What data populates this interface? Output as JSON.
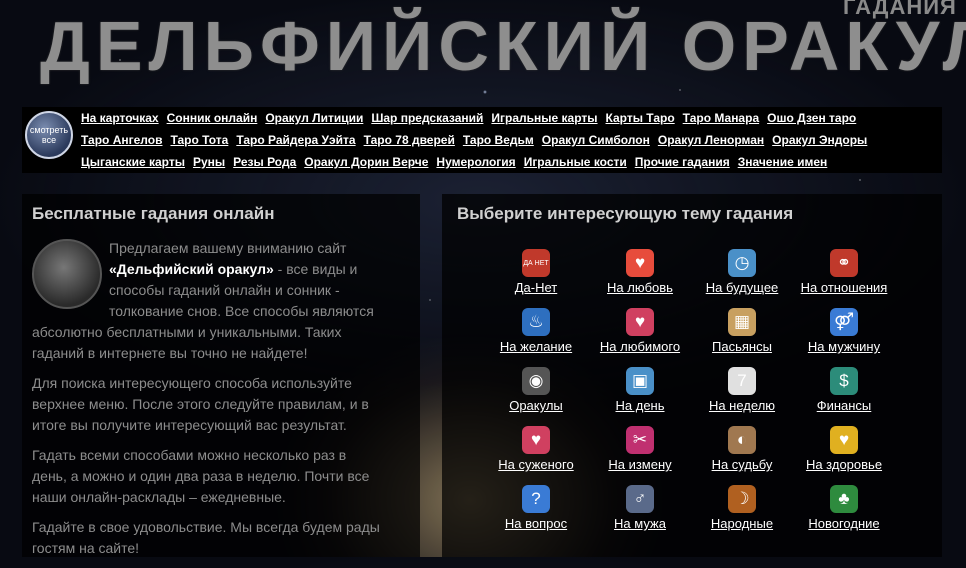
{
  "header": {
    "title": "ДЕЛЬФИЙСКИЙ ОРАКУЛ",
    "subtitle": "ГАДАНИЯ"
  },
  "menu": {
    "show_all": "смотреть все",
    "rows": [
      [
        "На карточках",
        "Сонник онлайн",
        "Оракул Литиции",
        "Шар предсказаний",
        "Игральные карты",
        "Карты Таро",
        "Таро Манара",
        "Ошо Дзен таро"
      ],
      [
        "Таро Ангелов",
        "Таро Тота",
        "Таро Райдера Уэйта",
        "Таро 78 дверей",
        "Таро Ведьм",
        "Оракул Симболон",
        "Оракул Ленорман",
        "Оракул Эндоры"
      ],
      [
        "Цыганские карты",
        "Руны",
        "Резы Рода",
        "Оракул Дорин Верче",
        "Нумерология",
        "Игральные кости",
        "Прочие гадания",
        "Значение имен"
      ]
    ]
  },
  "left_panel": {
    "title": "Бесплатные гадания онлайн",
    "p1_before": "Предлагаем вашему вниманию сайт ",
    "p1_bold": "«Дельфийский оракул»",
    "p1_after": " - все виды и способы гаданий онлайн и сонник - толкование снов. Все способы являются абсолютно бесплатными и уникальными. Таких гаданий в интернете вы точно не найдете!",
    "p2": "Для поиска интересующего способа используйте верхнее меню. После этого следуйте правилам, и в итоге вы получите интересующий вас результат.",
    "p3": "Гадать всеми способами можно несколько раз в день, а можно и один два раза в неделю. Почти все наши онлайн-расклады – ежедневные.",
    "p4": "Гадайте в свое удовольствие. Мы всегда будем рады гостям на сайте!"
  },
  "right_panel": {
    "title": "Выберите интересующую тему гадания",
    "items": [
      {
        "label": "Да-Нет",
        "icon": "yes-no-icon",
        "glyph": "ДА НЕТ",
        "color": "#c0392b"
      },
      {
        "label": "На любовь",
        "icon": "hearts-icon",
        "glyph": "♥",
        "color": "#e74c3c"
      },
      {
        "label": "На будущее",
        "icon": "clock-icon",
        "glyph": "◷",
        "color": "#4a90c8"
      },
      {
        "label": "На отношения",
        "icon": "couple-icon",
        "glyph": "⚭",
        "color": "#c0392b"
      },
      {
        "label": "На желание",
        "icon": "genie-lamp-icon",
        "glyph": "♨",
        "color": "#2e6fbf"
      },
      {
        "label": "На любимого",
        "icon": "heart-icon",
        "glyph": "♥",
        "color": "#d04060"
      },
      {
        "label": "Пасьянсы",
        "icon": "cards-icon",
        "glyph": "▦",
        "color": "#c8a060"
      },
      {
        "label": "На мужчину",
        "icon": "people-icon",
        "glyph": "⚤",
        "color": "#3a7bd5"
      },
      {
        "label": "Оракулы",
        "icon": "oracle-icon",
        "glyph": "◉",
        "color": "#555555"
      },
      {
        "label": "На день",
        "icon": "calendar-day-icon",
        "glyph": "▣",
        "color": "#4a90c8"
      },
      {
        "label": "На неделю",
        "icon": "calendar-week-icon",
        "glyph": "7",
        "color": "#e0e0e0"
      },
      {
        "label": "Финансы",
        "icon": "money-icon",
        "glyph": "$",
        "color": "#2c8c7a"
      },
      {
        "label": "На суженого",
        "icon": "hand-heart-icon",
        "glyph": "♥",
        "color": "#d04060"
      },
      {
        "label": "На измену",
        "icon": "betrayal-icon",
        "glyph": "✂",
        "color": "#c03070"
      },
      {
        "label": "На судьбу",
        "icon": "fate-icon",
        "glyph": "◐",
        "color": "#a07850"
      },
      {
        "label": "На здоровье",
        "icon": "health-icon",
        "glyph": "♥",
        "color": "#e0b020"
      },
      {
        "label": "На вопрос",
        "icon": "question-icon",
        "glyph": "?",
        "color": "#3a7bd5"
      },
      {
        "label": "На мужа",
        "icon": "husband-icon",
        "glyph": "♂",
        "color": "#5a6a8a"
      },
      {
        "label": "Народные",
        "icon": "folk-icon",
        "glyph": "☽",
        "color": "#b06020"
      },
      {
        "label": "Новогодние",
        "icon": "tree-icon",
        "glyph": "♣",
        "color": "#2e8b3e"
      }
    ]
  }
}
